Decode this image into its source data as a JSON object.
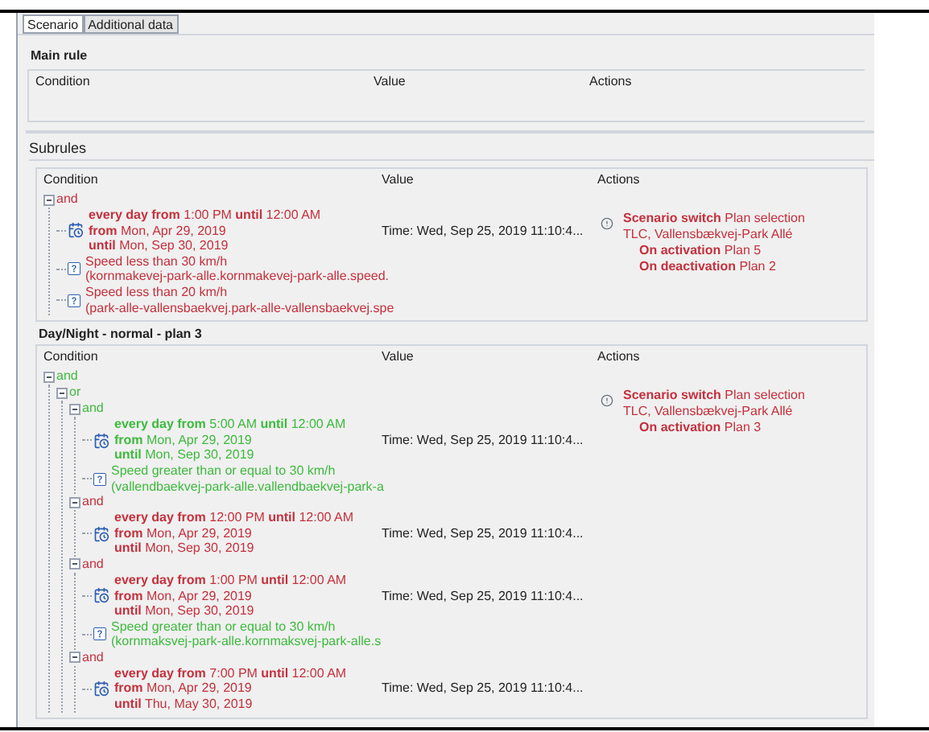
{
  "tabs": [
    {
      "label": "Scenario",
      "selected": true
    },
    {
      "label": "Additional data",
      "selected": false
    }
  ],
  "main_rule": {
    "title": "Main rule",
    "columns": [
      "Condition",
      "Value",
      "Actions"
    ]
  },
  "subrules": {
    "label": "Subrules",
    "rules": [
      {
        "columns": [
          "Condition",
          "Value",
          "Actions"
        ],
        "condition": {
          "kind": "group",
          "label": "and",
          "active": false,
          "expanded": true,
          "children": [
            {
              "kind": "time",
              "active": false,
              "lines": [
                "**every day from** 1:00 PM **until** 12:00 AM",
                "**from** Mon, Apr 29, 2019",
                "**until** Mon, Sep 30, 2019"
              ],
              "value": "Time: Wed, Sep 25, 2019 11:10:4..."
            },
            {
              "kind": "speed",
              "active": false,
              "lines": [
                "Speed less than 30 km/h",
                "(kornmakevej-park-alle.kornmakevej-park-alle.speed."
              ]
            },
            {
              "kind": "speed",
              "active": false,
              "lines": [
                "Speed less than 20 km/h",
                "(park-alle-vallensbaekvej.park-alle-vallensbaekvej.spe"
              ]
            }
          ]
        },
        "action": {
          "text": "**Scenario switch** Plan selection TLC, Vallensbækvej-Park Allé",
          "details": [
            "**On activation** Plan 5",
            "**On deactivation** Plan 2"
          ]
        }
      },
      {
        "title": "Day/Night - normal - plan 3",
        "columns": [
          "Condition",
          "Value",
          "Actions"
        ],
        "condition": {
          "kind": "group",
          "label": "and",
          "active": true,
          "expanded": true,
          "children": [
            {
              "kind": "group",
              "label": "or",
              "active": true,
              "expanded": true,
              "children": [
                {
                  "kind": "group",
                  "label": "and",
                  "active": true,
                  "expanded": true,
                  "children": [
                    {
                      "kind": "time",
                      "active": true,
                      "lines": [
                        "**every day from** 5:00 AM **until** 12:00 AM",
                        "**from** Mon, Apr 29, 2019",
                        "**until** Mon, Sep 30, 2019"
                      ],
                      "value": "Time: Wed, Sep 25, 2019 11:10:4..."
                    },
                    {
                      "kind": "speed",
                      "active": true,
                      "lines": [
                        "Speed greater than or equal to 30 km/h",
                        "(vallendbaekvej-park-alle.vallendbaekvej-park-a"
                      ]
                    }
                  ]
                },
                {
                  "kind": "group",
                  "label": "and",
                  "active": false,
                  "expanded": true,
                  "children": [
                    {
                      "kind": "time",
                      "active": false,
                      "lines": [
                        "**every day from** 12:00 PM **until** 12:00 AM",
                        "**from** Mon, Apr 29, 2019",
                        "**until** Mon, Sep 30, 2019"
                      ],
                      "value": "Time: Wed, Sep 25, 2019 11:10:4..."
                    }
                  ]
                },
                {
                  "kind": "group",
                  "label": "and",
                  "active": false,
                  "expanded": true,
                  "children": [
                    {
                      "kind": "time",
                      "active": false,
                      "lines": [
                        "**every day from** 1:00 PM **until** 12:00 AM",
                        "**from** Mon, Apr 29, 2019",
                        "**until** Mon, Sep 30, 2019"
                      ],
                      "value": "Time: Wed, Sep 25, 2019 11:10:4..."
                    },
                    {
                      "kind": "speed",
                      "active": true,
                      "lines": [
                        "Speed greater than or equal to 30 km/h",
                        "(kornmaksvej-park-alle.kornmaksvej-park-alle.s"
                      ]
                    }
                  ]
                },
                {
                  "kind": "group",
                  "label": "and",
                  "active": false,
                  "expanded": true,
                  "children": [
                    {
                      "kind": "time",
                      "active": false,
                      "lines": [
                        "**every day from** 7:00 PM **until** 12:00 AM",
                        "**from** Mon, Apr 29, 2019",
                        "**until** Thu, May 30, 2019"
                      ],
                      "value": "Time: Wed, Sep 25, 2019 11:10:4..."
                    }
                  ]
                }
              ]
            }
          ]
        },
        "action": {
          "text": "**Scenario switch** Plan selection TLC, Vallensbækvej-Park Allé",
          "details": [
            "**On activation** Plan 3"
          ]
        }
      }
    ]
  }
}
